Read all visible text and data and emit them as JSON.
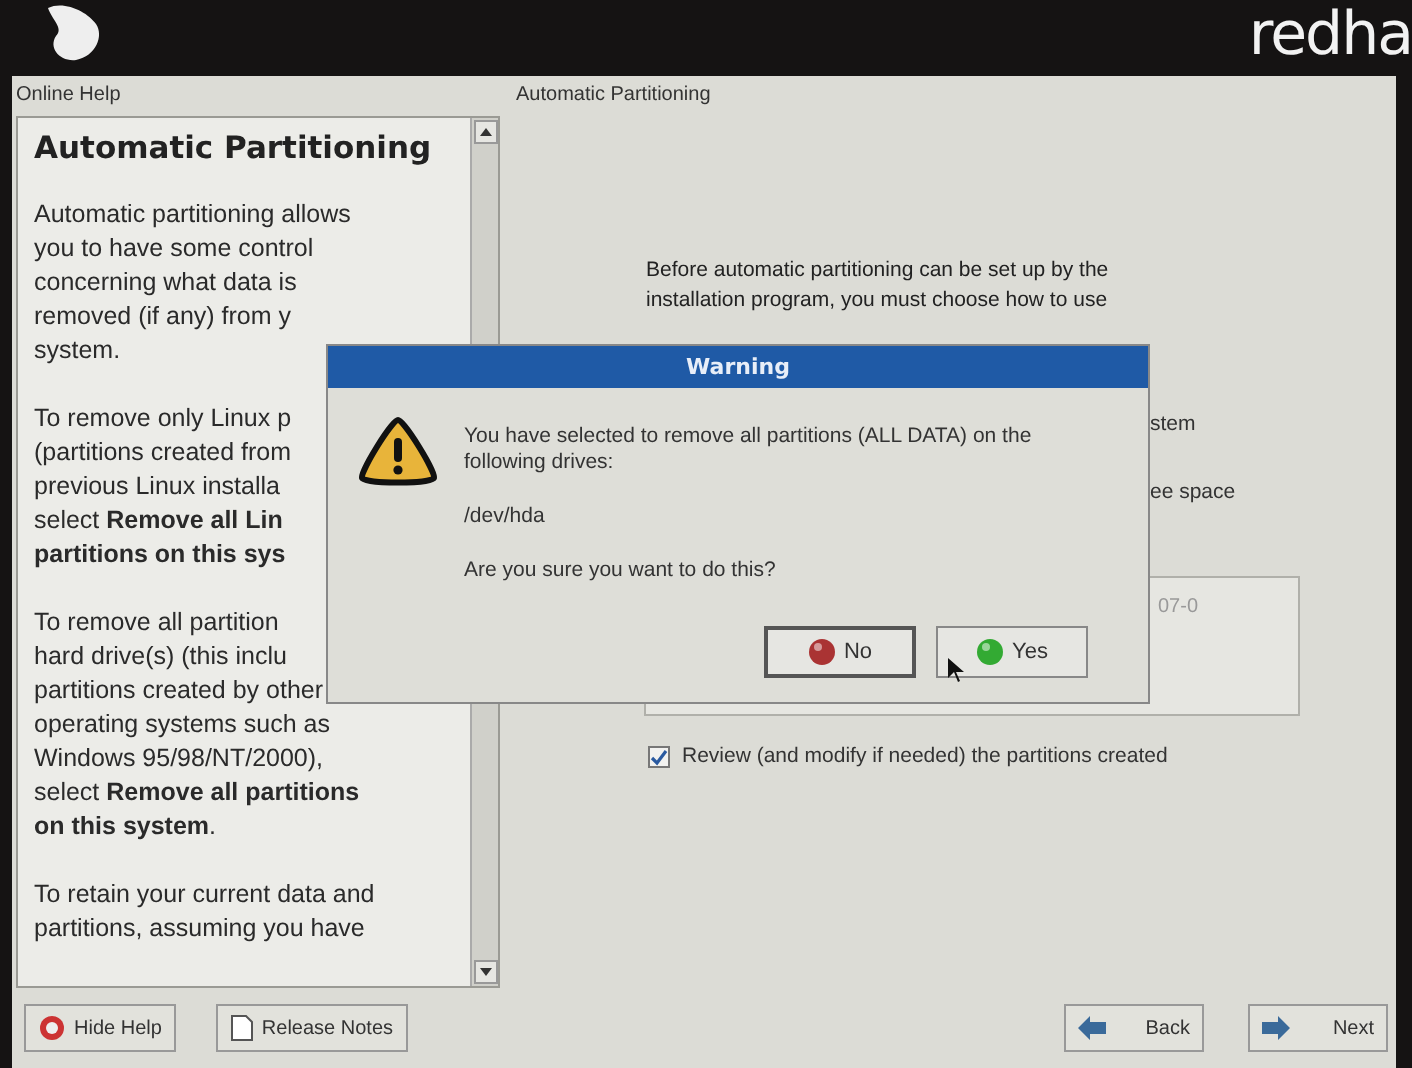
{
  "header": {
    "logo_text": "redha"
  },
  "help": {
    "heading": "Online Help",
    "title": "Automatic Partitioning",
    "paragraphs": [
      [
        "Automatic partitioning allows",
        "you to have some control",
        "concerning what data is",
        "removed (if any) from y",
        "system."
      ],
      [
        "To remove only Linux p",
        "(partitions created from",
        "previous Linux installa",
        "select **Remove all Lin**",
        "**partitions on this sys**"
      ],
      [
        "To remove all partition",
        "hard drive(s) (this inclu",
        "partitions created by other",
        "operating systems such as",
        "Windows 95/98/NT/2000),",
        "select **Remove all partitions**",
        "**on this system**."
      ],
      [
        "To retain your current data and",
        "partitions, assuming you have"
      ]
    ],
    "buttons": [
      {
        "label": "Hide Help",
        "kind": "help"
      },
      {
        "label": "Release Notes",
        "kind": "notes"
      }
    ]
  },
  "main": {
    "heading": "Automatic Partitioning",
    "intro": [
      "Before automatic partitioning can be set up by the",
      "installation program, you must choose how to use"
    ],
    "fragments": [
      "stem",
      "ee space"
    ],
    "list_fragment": "07-0",
    "review": {
      "label": "Review (and modify if needed) the partitions created",
      "checked": true
    }
  },
  "nav_buttons": [
    {
      "label": "Back",
      "kind": "back"
    },
    {
      "label": "Next",
      "kind": "next"
    }
  ],
  "dialog": {
    "title": "Warning",
    "message": [
      "You have selected to remove all partitions (ALL DATA) on the",
      "following drives:"
    ],
    "drive": "/dev/hda",
    "question": "Are you sure you want to do this?",
    "buttons": [
      {
        "label": "No",
        "kind": "no"
      },
      {
        "label": "Yes",
        "kind": "yes"
      }
    ]
  }
}
